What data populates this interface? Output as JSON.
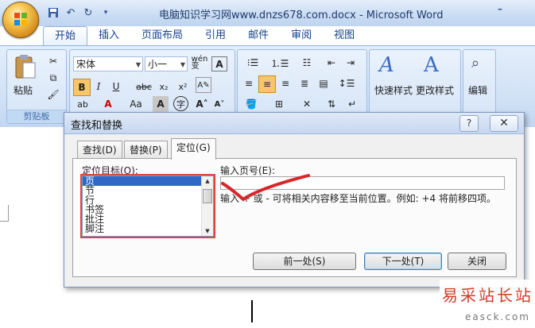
{
  "window": {
    "title": "电脑知识学习网www.dnzs678.com.docx - Microsoft Word",
    "minimize_glyph": "–"
  },
  "quick_access": [
    "save-icon",
    "undo-icon",
    "redo-icon",
    "customize-icon"
  ],
  "ribbon": {
    "tabs": [
      "开始",
      "插入",
      "页面布局",
      "引用",
      "邮件",
      "审阅",
      "视图"
    ],
    "active_tab": "开始",
    "clipboard": {
      "paste_label": "粘贴",
      "group_label": "剪贴板"
    },
    "font": {
      "name": "宋体",
      "size": "小一",
      "wen_label": "wén\n变"
    },
    "styles": {
      "quick_styles": "快速样式",
      "change_styles": "更改样式"
    },
    "editing": {
      "label": "编辑"
    }
  },
  "dialog": {
    "title": "查找和替换",
    "help": "?",
    "close": "✕",
    "tabs": [
      "查找(D)",
      "替换(P)",
      "定位(G)"
    ],
    "active_tab": "定位(G)",
    "target_label": "定位目标(O):",
    "targets": [
      "页",
      "节",
      "行",
      "书签",
      "批注",
      "脚注"
    ],
    "selected_target": "页",
    "page_label": "输入页号(E):",
    "page_value": "",
    "hint": "输入 + 或 - 可将相关内容移至当前位置。例如: +4 将前移四项。",
    "buttons": {
      "previous": "前一处(S)",
      "next": "下一处(T)",
      "close": "关闭"
    }
  },
  "watermark": {
    "text": "易采站长站",
    "url": "easck.com"
  },
  "colors": {
    "accent": "#3168c6",
    "annotation": "#d9262b",
    "ribbon": "#cfe0f5"
  }
}
